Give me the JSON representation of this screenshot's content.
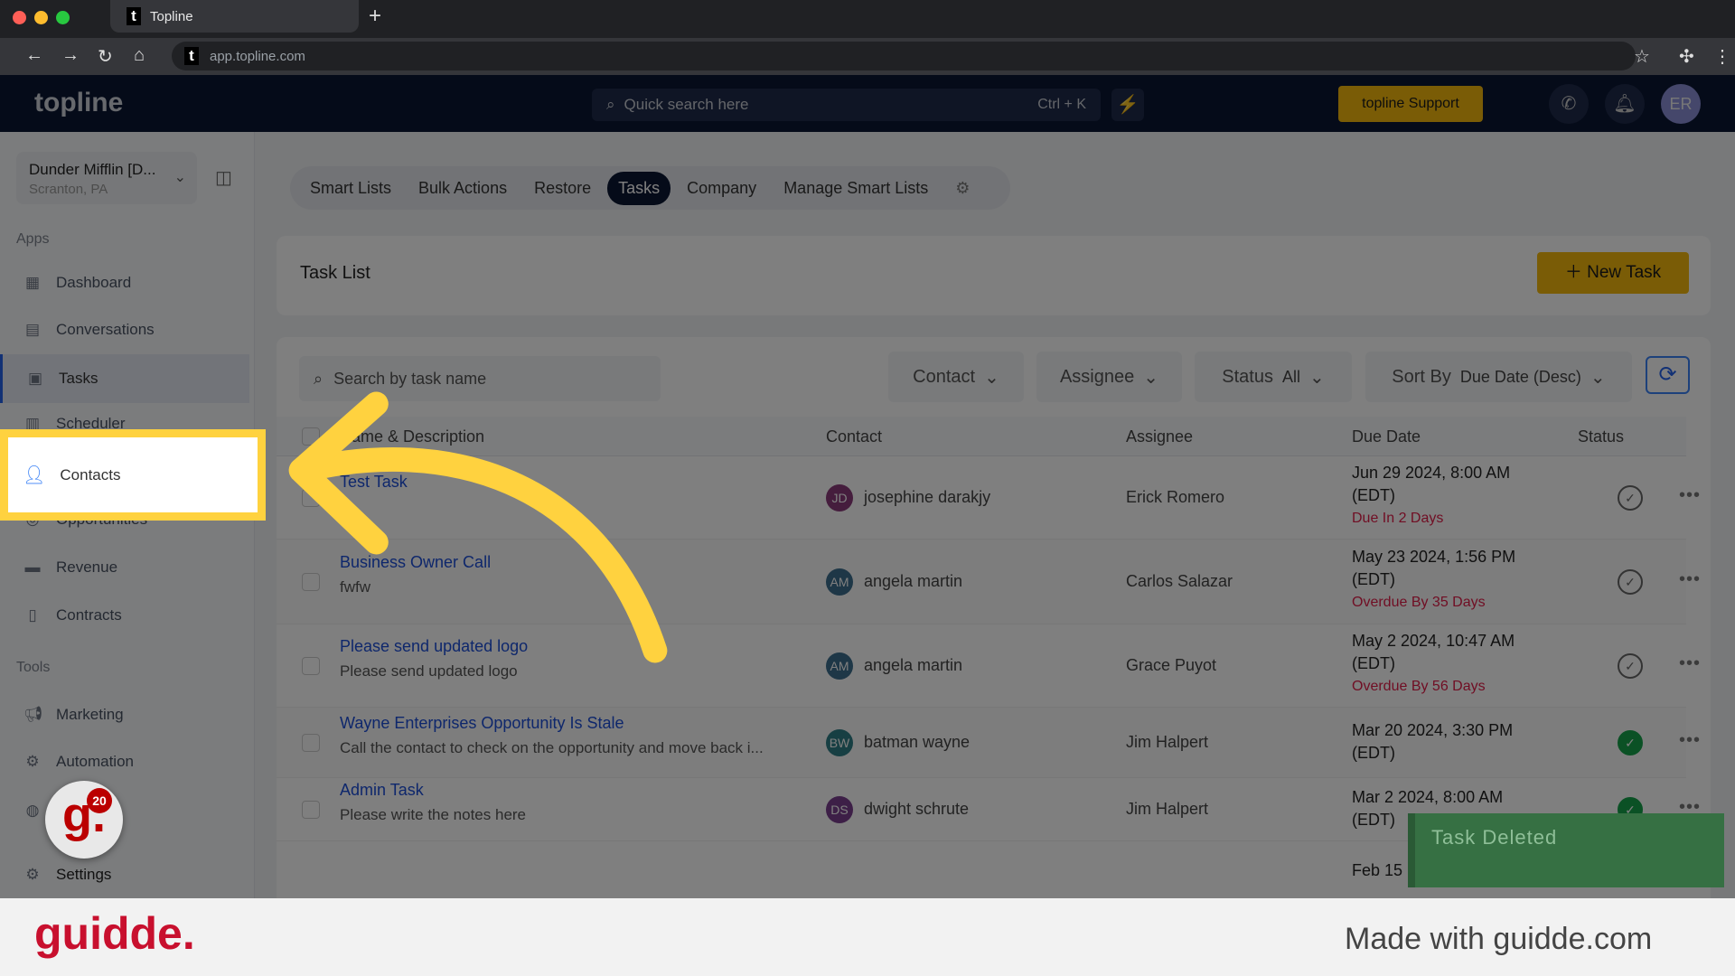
{
  "browser": {
    "tab_title": "Topline",
    "url": "app.topline.com",
    "favicon": "t"
  },
  "header": {
    "logo": "topline",
    "search_placeholder": "Quick search here",
    "search_shortcut": "Ctrl + K",
    "support_label": "topline Support",
    "avatar_initials": "ER"
  },
  "sidebar": {
    "location_name": "Dunder Mifflin [D...",
    "location_city": "Scranton, PA",
    "apps_heading": "Apps",
    "tools_heading": "Tools",
    "apps": [
      {
        "label": "Dashboard",
        "icon": "dashboard-icon"
      },
      {
        "label": "Conversations",
        "icon": "chat-icon"
      },
      {
        "label": "Tasks",
        "icon": "tasks-icon",
        "active": true
      },
      {
        "label": "Scheduler",
        "icon": "calendar-icon"
      },
      {
        "label": "Contacts",
        "icon": "person-icon"
      },
      {
        "label": "Opportunities",
        "icon": "target-icon"
      },
      {
        "label": "Revenue",
        "icon": "card-icon"
      },
      {
        "label": "Contracts",
        "icon": "document-icon"
      }
    ],
    "tools": [
      {
        "label": "Marketing",
        "icon": "megaphone-icon"
      },
      {
        "label": "Automation",
        "icon": "gears-icon"
      }
    ],
    "settings_label": "Settings"
  },
  "main": {
    "tabs": [
      {
        "label": "Smart Lists"
      },
      {
        "label": "Bulk Actions"
      },
      {
        "label": "Restore"
      },
      {
        "label": "Tasks",
        "active": true
      },
      {
        "label": "Company"
      },
      {
        "label": "Manage Smart Lists"
      }
    ],
    "task_list_title": "Task List",
    "new_task_label": "New Task",
    "search_placeholder": "Search by task name",
    "filters": {
      "contact": "Contact",
      "assignee": "Assignee",
      "status_label": "Status",
      "status_value": "All",
      "sort_label": "Sort By",
      "sort_value": "Due Date (Desc)"
    },
    "columns": [
      "Name & Description",
      "Contact",
      "Assignee",
      "Due Date",
      "Status"
    ],
    "rows": [
      {
        "name": "Test Task",
        "desc": "",
        "initials": "JD",
        "avatar_color": "#8b3a7a",
        "contact": "josephine darakjy",
        "assignee": "Erick Romero",
        "due": "Jun 29 2024, 8:00 AM",
        "tz": "(EDT)",
        "rel": "Due In 2 Days",
        "done": false
      },
      {
        "name": "Business Owner Call",
        "desc": "fwfw",
        "initials": "AM",
        "avatar_color": "#3d6f8e",
        "contact": "angela martin",
        "assignee": "Carlos Salazar",
        "due": "May 23 2024, 1:56 PM",
        "tz": "(EDT)",
        "rel": "Overdue By 35 Days",
        "done": false
      },
      {
        "name": "Please send updated logo",
        "desc": "Please send updated logo",
        "initials": "AM",
        "avatar_color": "#3d6f8e",
        "contact": "angela martin",
        "assignee": "Grace Puyot",
        "due": "May 2 2024, 10:47 AM",
        "tz": "(EDT)",
        "rel": "Overdue By 56 Days",
        "done": false
      },
      {
        "name": "Wayne Enterprises Opportunity Is Stale",
        "desc": "Call the contact to check on the opportunity and move back i...",
        "initials": "BW",
        "avatar_color": "#2f7f86",
        "contact": "batman wayne",
        "assignee": "Jim Halpert",
        "due": "Mar 20 2024, 3:30 PM",
        "tz": "(EDT)",
        "rel": "",
        "done": true
      },
      {
        "name": "Admin Task",
        "desc": "Please write the notes here",
        "initials": "DS",
        "avatar_color": "#7a3f8f",
        "contact": "dwight schrute",
        "assignee": "Jim Halpert",
        "due": "Mar 2 2024, 8:00 AM",
        "tz": "(EDT)",
        "rel": "",
        "done": true
      }
    ],
    "partial_due": "Feb 15"
  },
  "toast": "Task Deleted",
  "guidde": {
    "badge": "20",
    "logo": "guidde.",
    "made_with": "Made with guidde.com"
  },
  "colors": {
    "accent": "#f5b90d",
    "highlight": "#ffd23f",
    "header": "#0b1633",
    "toast": "#367043"
  }
}
